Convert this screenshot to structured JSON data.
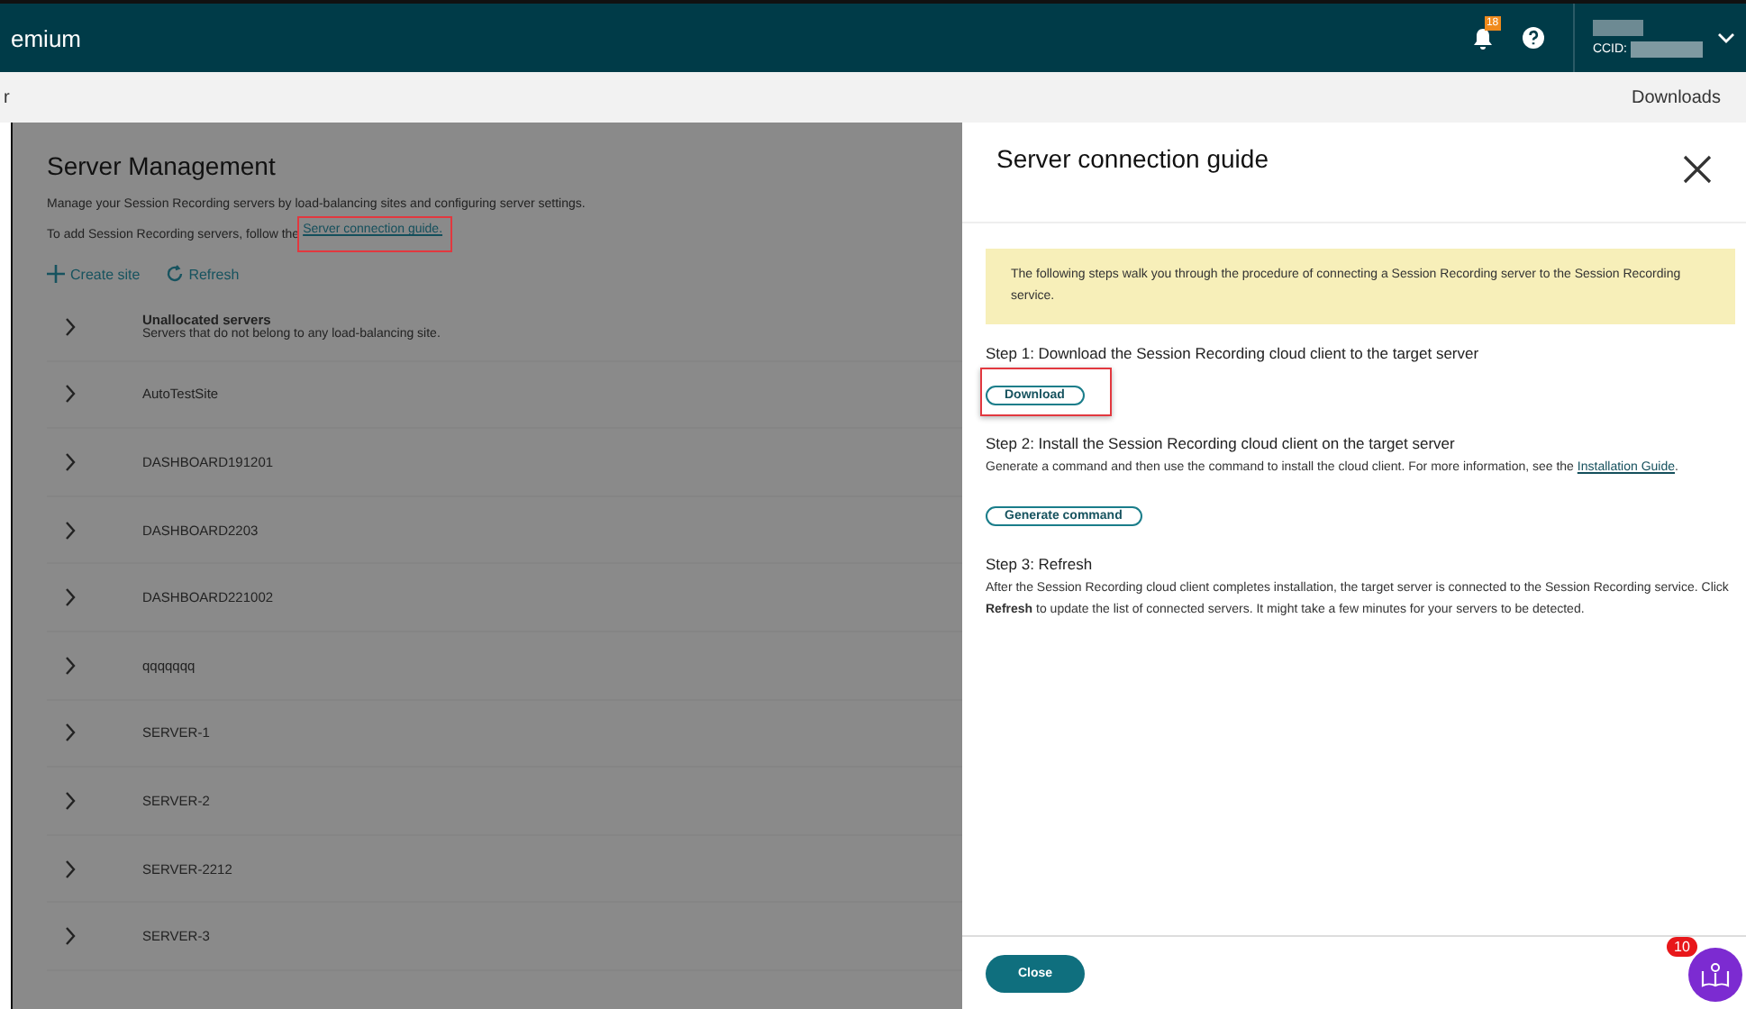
{
  "topbar": {
    "brand": "emium",
    "notification_count": "18",
    "account_label": "CCID:"
  },
  "subbar": {
    "breadcrumb": "r",
    "downloads": "Downloads"
  },
  "page": {
    "title": "Server Management",
    "description": "Manage your Session Recording servers by load-balancing sites and configuring server settings.",
    "add_text": "To add Session Recording servers, follow the ",
    "add_link": "Server connection guide.",
    "actions": [
      "Create site",
      "Refresh"
    ],
    "sites": [
      {
        "name": "Unallocated servers",
        "subtitle": "Servers that do not belong to any load-balancing site."
      },
      {
        "name": "AutoTestSite"
      },
      {
        "name": "DASHBOARD191201"
      },
      {
        "name": "DASHBOARD2203"
      },
      {
        "name": "DASHBOARD221002"
      },
      {
        "name": "qqqqqqq"
      },
      {
        "name": "SERVER-1"
      },
      {
        "name": "SERVER-2"
      },
      {
        "name": "SERVER-2212"
      },
      {
        "name": "SERVER-3"
      }
    ]
  },
  "panel": {
    "title": "Server connection guide",
    "notice": "The following steps walk you through the procedure of connecting a Session Recording server to the Session Recording service.",
    "steps": [
      {
        "title": "Step 1: Download the Session Recording cloud client to the target server",
        "button": "Download",
        "highlighted": true
      },
      {
        "title": "Step 2: Install the Session Recording cloud client on the target server",
        "text": "Generate a command and then use the command to install the cloud client. For more information, see the ",
        "link": "Installation Guide",
        "text_end": ".",
        "button": "Generate command",
        "highlighted": false
      },
      {
        "title": "Step 3: Refresh",
        "text": "After the Session Recording cloud client completes installation, the target server is connected to the Session Recording service. Click **Refresh** to update the list of connected servers. It might take a few minutes for your servers to be detected."
      }
    ],
    "close_button": "Close"
  },
  "help_badge": "10"
}
